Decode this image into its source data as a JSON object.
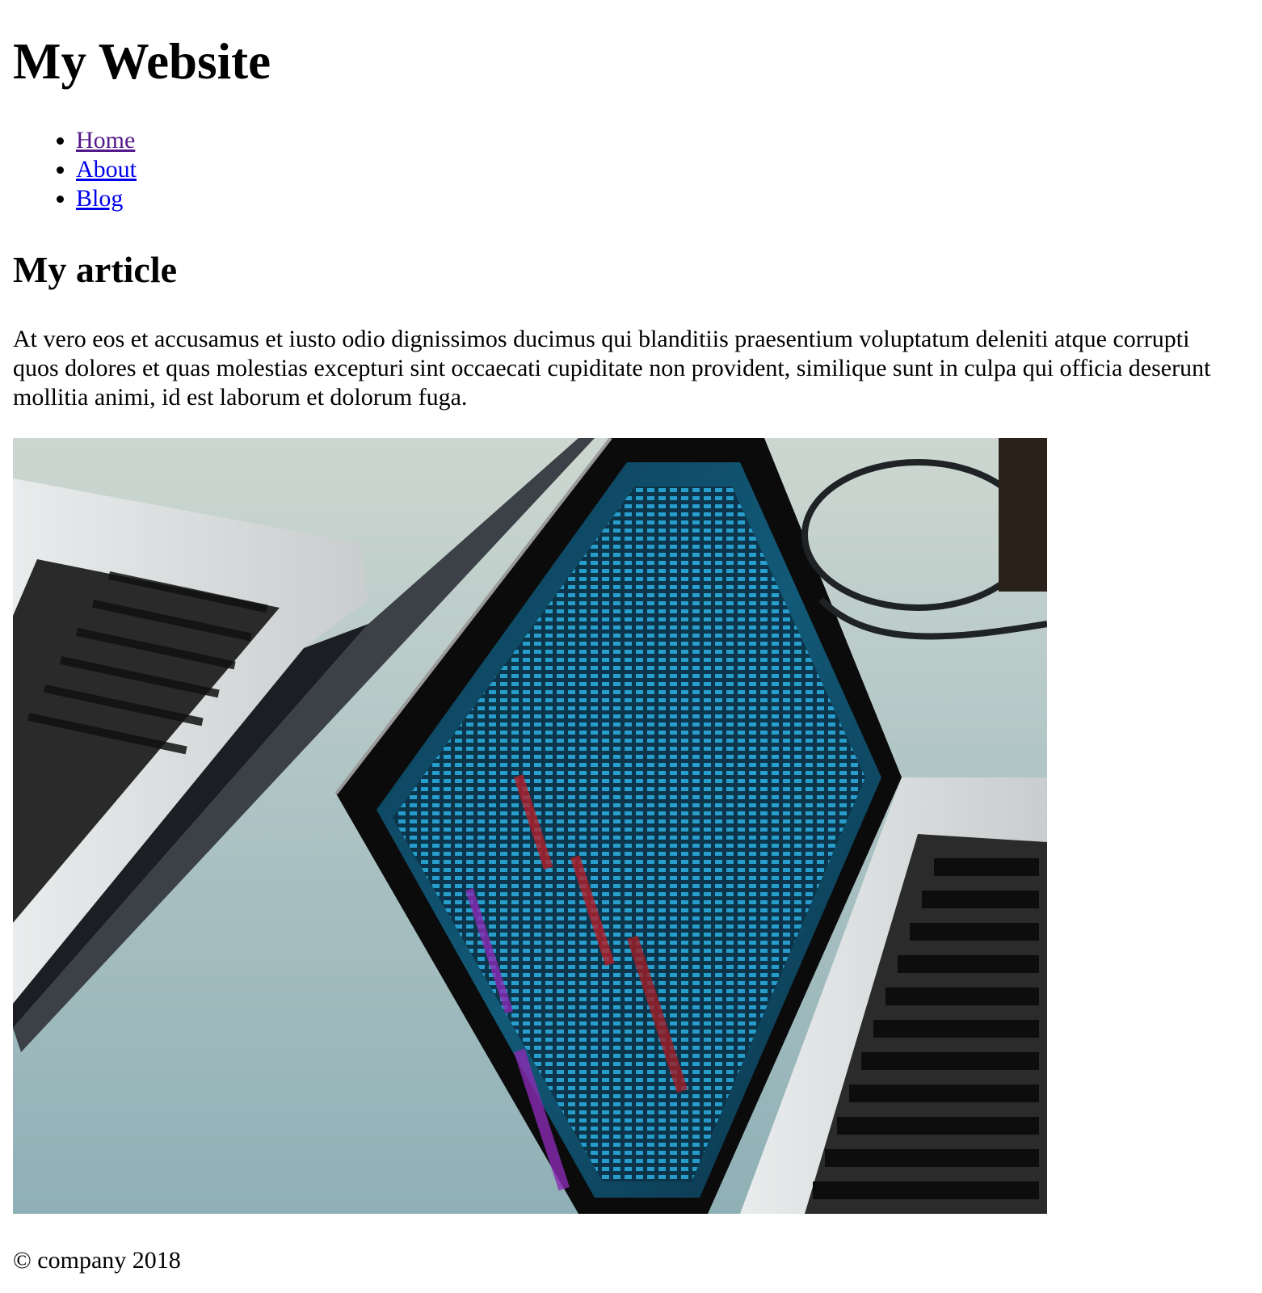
{
  "header": {
    "title": "My Website"
  },
  "nav": {
    "items": [
      {
        "label": "Home",
        "visited": true
      },
      {
        "label": "About",
        "visited": false
      },
      {
        "label": "Blog",
        "visited": false
      }
    ]
  },
  "article": {
    "title": "My article",
    "body": "At vero eos et accusamus et iusto odio dignissimos ducimus qui blanditiis praesentium voluptatum deleniti atque corrupti quos dolores et quas molestias excepturi sint occaecati cupiditate non provident, similique sunt in culpa qui officia deserunt mollitia animi, id est laborum et dolorum fuga.",
    "image": {
      "subject": "photo-two-laptops-with-code-screen"
    }
  },
  "footer": {
    "text": "© company 2018"
  },
  "colors": {
    "link": "#0000ee",
    "link_visited": "#551a8b",
    "text": "#000000",
    "background": "#ffffff"
  }
}
